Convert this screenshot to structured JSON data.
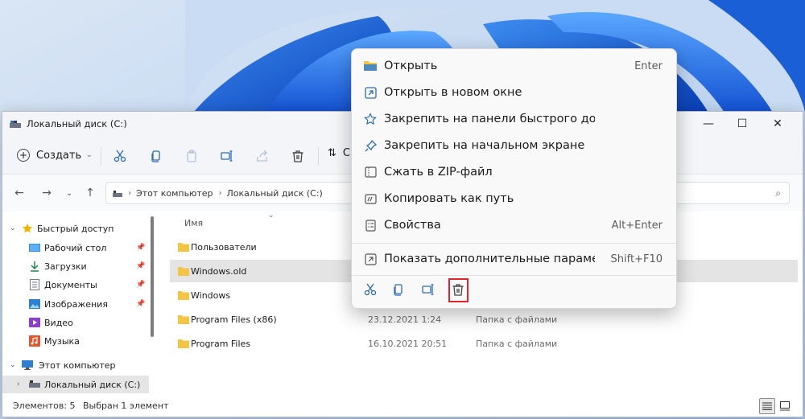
{
  "window": {
    "title": "Локальный диск (C:)",
    "controls": {
      "minimize": "—",
      "maximize": "☐",
      "close": "✕"
    }
  },
  "commandbar": {
    "create_label": "Создать",
    "sort_label_partial": "С"
  },
  "address": {
    "segments": [
      "Этот компьютер",
      "Локальный диск (C:)"
    ]
  },
  "sidebar": {
    "items": [
      {
        "label": "Быстрый доступ",
        "icon": "star-icon"
      },
      {
        "label": "Рабочий стол",
        "icon": "desktop-icon"
      },
      {
        "label": "Загрузки",
        "icon": "download-icon"
      },
      {
        "label": "Документы",
        "icon": "documents-icon"
      },
      {
        "label": "Изображения",
        "icon": "images-icon"
      },
      {
        "label": "Видео",
        "icon": "video-icon"
      },
      {
        "label": "Музыка",
        "icon": "music-icon"
      },
      {
        "label": "Этот компьютер",
        "icon": "pc-icon"
      },
      {
        "label": "Локальный диск (C:)",
        "icon": "drive-icon"
      }
    ]
  },
  "filelist": {
    "column_name": "Имя",
    "rows": [
      {
        "name": "Пользователи",
        "date": "",
        "type": ""
      },
      {
        "name": "Windows.old",
        "date": "",
        "type": ""
      },
      {
        "name": "Windows",
        "date": "",
        "type": ""
      },
      {
        "name": "Program Files (x86)",
        "date": "23.12.2021 1:24",
        "type": "Папка с файлами"
      },
      {
        "name": "Program Files",
        "date": "16.10.2021 20:51",
        "type": "Папка с файлами"
      }
    ]
  },
  "status": {
    "items_count": "Элементов: 5",
    "selected": "Выбран 1 элемент"
  },
  "context_menu": {
    "items": [
      {
        "label": "Открыть",
        "shortcut": "Enter",
        "icon": "folder-icon"
      },
      {
        "label": "Открыть в новом окне",
        "shortcut": "",
        "icon": "open-new-window-icon"
      },
      {
        "label": "Закрепить на панели быстрого доступа",
        "shortcut": "",
        "icon": "star-outline-icon"
      },
      {
        "label": "Закрепить на начальном экране",
        "shortcut": "",
        "icon": "pin-icon"
      },
      {
        "label": "Сжать в ZIP-файл",
        "shortcut": "",
        "icon": "zip-icon"
      },
      {
        "label": "Копировать как путь",
        "shortcut": "",
        "icon": "copy-path-icon"
      },
      {
        "label": "Свойства",
        "shortcut": "Alt+Enter",
        "icon": "properties-icon"
      },
      {
        "label": "Показать дополнительные параметры",
        "shortcut": "Shift+F10",
        "icon": "more-options-icon"
      }
    ],
    "bottom_actions": [
      "cut-icon",
      "copy-icon",
      "rename-icon",
      "delete-icon"
    ]
  },
  "colors": {
    "accent": "#0067c0",
    "highlight": "#e0262d",
    "folder": "#f4c542"
  }
}
